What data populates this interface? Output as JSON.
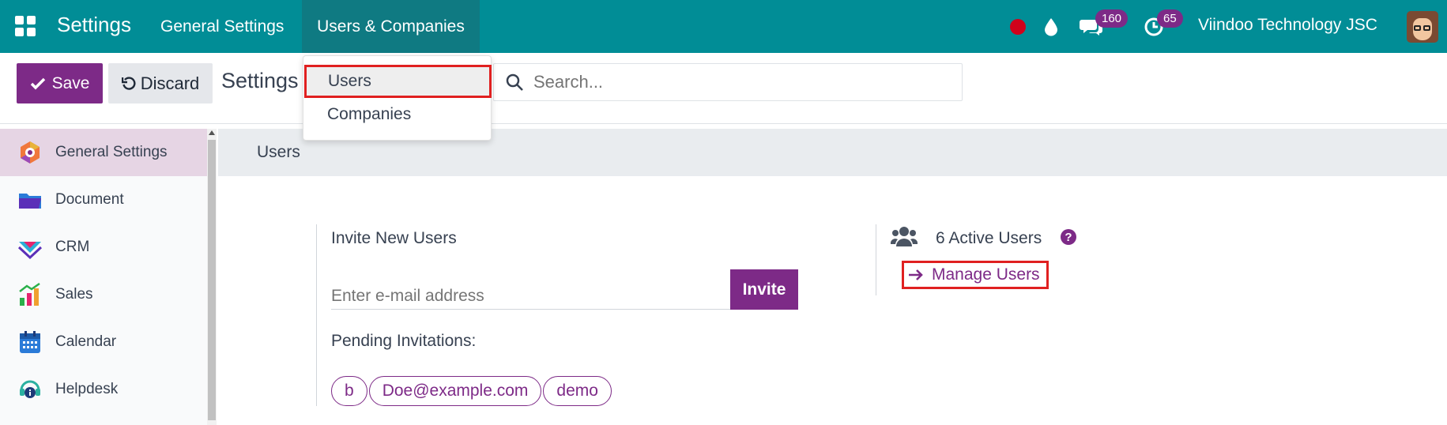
{
  "topbar": {
    "brand": "Settings",
    "menus": [
      "General Settings",
      "Users & Companies"
    ],
    "chat_count": "160",
    "activity_count": "65",
    "company": "Viindoo Technology JSC",
    "bg": "#018d96"
  },
  "controlbar": {
    "save": "Save",
    "discard": "Discard",
    "title": "Settings",
    "search_placeholder": "Search..."
  },
  "dropdown": {
    "items": [
      "Users",
      "Companies"
    ]
  },
  "sidebar": {
    "items": [
      {
        "label": "General Settings",
        "icon": "general-settings-icon"
      },
      {
        "label": "Document",
        "icon": "folder-icon"
      },
      {
        "label": "CRM",
        "icon": "crm-icon"
      },
      {
        "label": "Sales",
        "icon": "sales-icon"
      },
      {
        "label": "Calendar",
        "icon": "calendar-icon"
      },
      {
        "label": "Helpdesk",
        "icon": "helpdesk-icon"
      }
    ]
  },
  "section": {
    "header": "Users",
    "invite_title": "Invite New Users",
    "email_placeholder": "Enter e-mail address",
    "invite_button": "Invite",
    "pending": "Pending Invitations:",
    "tags": [
      "b",
      "Doe@example.com",
      "demo"
    ],
    "active_users": "6 Active Users",
    "manage_users": "Manage Users"
  },
  "colors": {
    "accent": "#7d2a87",
    "highlight": "#e02020"
  }
}
